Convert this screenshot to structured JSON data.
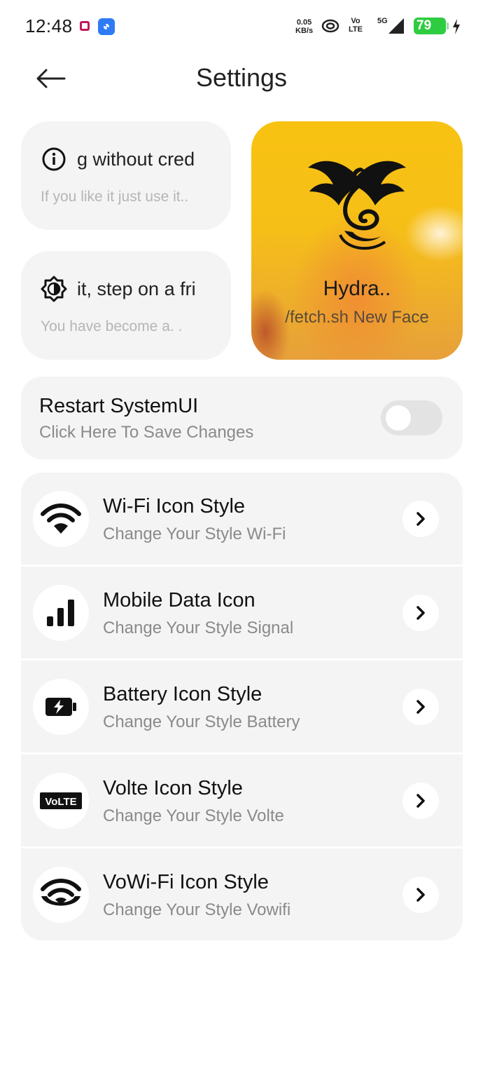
{
  "status_bar": {
    "time": "12:48",
    "net_speed_value": "0.05",
    "net_speed_unit": "KB/s",
    "volte_top": "Vo",
    "volte_bottom": "LTE",
    "network": "5G",
    "battery": "79"
  },
  "header": {
    "title": "Settings"
  },
  "cards": {
    "info": {
      "title": "g without cred",
      "subtitle": "If you like it just use it.."
    },
    "theme": {
      "title": "it, step on a fri",
      "subtitle": "You have become a. ."
    },
    "hero": {
      "name": "Hydra..",
      "subtitle": "/fetch.sh New Face"
    }
  },
  "restart": {
    "title": "Restart SystemUI",
    "subtitle": "Click Here To Save Changes",
    "toggle_on": false
  },
  "settings_list": [
    {
      "icon": "wifi-icon",
      "title": "Wi-Fi Icon Style",
      "subtitle": "Change Your Style Wi-Fi"
    },
    {
      "icon": "signal-bars-icon",
      "title": "Mobile Data Icon",
      "subtitle": "Change Your Style Signal"
    },
    {
      "icon": "battery-icon",
      "title": "Battery Icon Style",
      "subtitle": "Change Your Style Battery"
    },
    {
      "icon": "volte-icon",
      "title": "Volte Icon Style",
      "subtitle": "Change Your Style Volte",
      "icon_text": "VoLTE"
    },
    {
      "icon": "vowifi-icon",
      "title": "VoWi-Fi Icon Style",
      "subtitle": "Change Your Style Vowifi"
    }
  ],
  "colors": {
    "accent_battery": "#2ecc40",
    "card_bg": "#f4f4f4",
    "hero_bg": "#f8c212"
  }
}
